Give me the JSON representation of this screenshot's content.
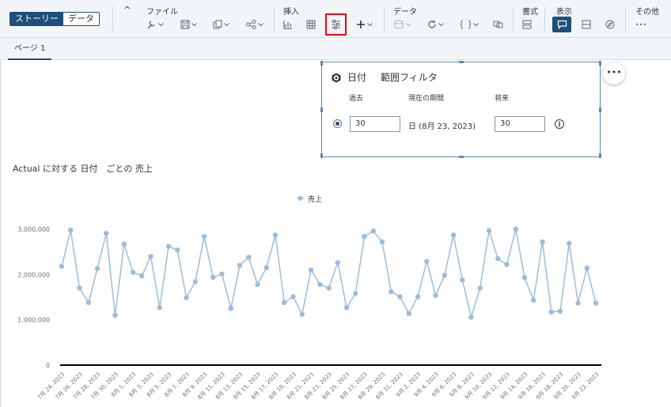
{
  "toolbar": {
    "mode_story": "ストーリー",
    "mode_data": "データ",
    "collapse_glyph": "^",
    "groups": {
      "file": "ファイル",
      "insert": "挿入",
      "data": "データ",
      "format": "書式",
      "view": "表示",
      "more": "その他"
    },
    "more_glyph": "•••"
  },
  "tabs": {
    "page1": "ページ 1"
  },
  "filter": {
    "title": "日付",
    "subtitle": "範囲フィルタ",
    "col_past": "過去",
    "col_current": "現在の期間",
    "col_future": "将来",
    "past_value": "30",
    "current_value": "日 (8月 23, 2023)",
    "future_value": "30",
    "info_glyph": "i",
    "more_glyph": "•••"
  },
  "colors": {
    "brand": "#1d4f7a",
    "highlight": "#e30613",
    "line": "#9bbcdd",
    "panel_border": "#5b88b4"
  },
  "icons": [
    "wrench-icon",
    "save-icon",
    "copy-icon",
    "share-icon",
    "table-layout-icon",
    "grid-icon",
    "input-control-icon",
    "plus-icon",
    "data-icon",
    "refresh-icon",
    "formula-icon",
    "link-dimension-icon",
    "format-icon",
    "comment-icon",
    "sidebar-icon",
    "compass-icon",
    "more-icon",
    "cube-icon",
    "info-icon"
  ],
  "chart_data": {
    "type": "line",
    "title": "Actual に対する 日付　ごとの 売上",
    "legend": "売上",
    "legend_position": "top-center",
    "ylim": [
      0,
      3000000
    ],
    "yticks": [
      "0",
      "1,000,000",
      "2,000,000",
      "3,000,000"
    ],
    "ytick_values": [
      0,
      1000000,
      2000000,
      3000000
    ],
    "grid": false,
    "xlabels": [
      "7月 24, 2023",
      "7月 26, 2023",
      "7月 28, 2023",
      "7月 30, 2023",
      "8月 1, 2023",
      "8月 3, 2023",
      "8月 5, 2023",
      "8月 7, 2023",
      "8月 9, 2023",
      "8月 11, 2023",
      "8月 13, 2023",
      "8月 15, 2023",
      "8月 17, 2023",
      "8月 19, 2023",
      "8月 21, 2023",
      "8月 23, 2023",
      "8月 25, 2023",
      "8月 27, 2023",
      "8月 29, 2023",
      "8月 31, 2023",
      "9月 2, 2023",
      "9月 4, 2023",
      "9月 6, 2023",
      "9月 8, 2023",
      "9月 10, 2023",
      "9月 12, 2023",
      "9月 14, 2023",
      "9月 16, 2023",
      "9月 18, 2023",
      "9月 20, 2023",
      "9月 22, 2023"
    ],
    "series": [
      {
        "name": "売上",
        "values": [
          2180000,
          2980000,
          1700000,
          1380000,
          2130000,
          2910000,
          1100000,
          2670000,
          2050000,
          1970000,
          2400000,
          1270000,
          2620000,
          2540000,
          1490000,
          1840000,
          2840000,
          1940000,
          2010000,
          1250000,
          2200000,
          2380000,
          1780000,
          2150000,
          2870000,
          1380000,
          1510000,
          1120000,
          2100000,
          1780000,
          1700000,
          2260000,
          1270000,
          1580000,
          2840000,
          2960000,
          2720000,
          1620000,
          1510000,
          1140000,
          1510000,
          2290000,
          1540000,
          1980000,
          2870000,
          1880000,
          1060000,
          1700000,
          2970000,
          2350000,
          2220000,
          3000000,
          1930000,
          1430000,
          2720000,
          1170000,
          1190000,
          2690000,
          1370000,
          2140000,
          1370000
        ]
      }
    ]
  }
}
